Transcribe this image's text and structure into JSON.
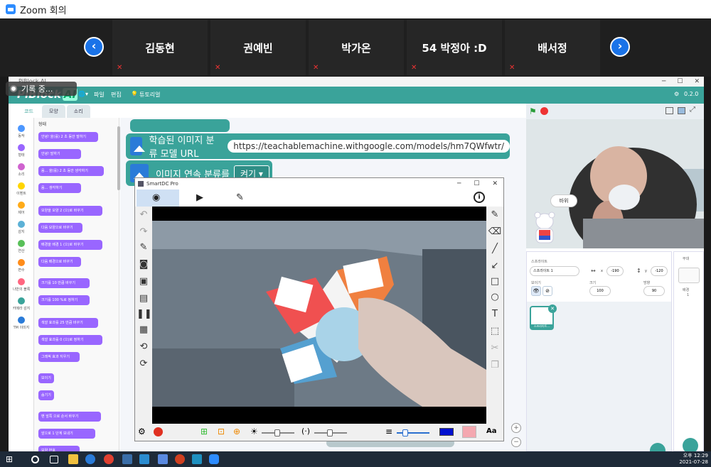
{
  "zoom": {
    "title": "Zoom 회의"
  },
  "participants": [
    "김동현",
    "권예빈",
    "박가온",
    "54 박정아 :D",
    "배서정"
  ],
  "piblock": {
    "window_title": "PiBlock AI",
    "logo": "PiBlock",
    "logo_ai": "AI",
    "recording": "기록 중...",
    "menus": [
      "파일",
      "편집",
      "튜토리얼"
    ],
    "version": "0.2.0",
    "tabs": [
      "코드",
      "모양",
      "소리"
    ],
    "categories": [
      {
        "label": "동작",
        "color": "#4c97ff"
      },
      {
        "label": "형태",
        "color": "#9966ff"
      },
      {
        "label": "소리",
        "color": "#cf63cf"
      },
      {
        "label": "이벤트",
        "color": "#ffd500"
      },
      {
        "label": "제어",
        "color": "#ffab19"
      },
      {
        "label": "감지",
        "color": "#5cb1d6"
      },
      {
        "label": "연산",
        "color": "#59c059"
      },
      {
        "label": "변수",
        "color": "#ff8c1a"
      },
      {
        "label": "나만의 블록",
        "color": "#ff6680"
      },
      {
        "label": "카메라 감지",
        "color": "#3aa39a"
      },
      {
        "label": "TM 이미지",
        "color": "#2a7bd8"
      }
    ],
    "palette_heading": "형태",
    "palette_blocks": [
      "안녕! 을(를) 2 초 동안 말하기",
      "안녕! 말하기",
      "음... 을(를) 2 초 동안 생각하기",
      "음... 생각하기",
      "모양을 모양 2 (으)로 바꾸기",
      "다음 모양으로 바꾸기",
      "배경을 배경 1 (으)로 바꾸기",
      "다음 배경으로 바꾸기",
      "크기를 10 만큼 바꾸기",
      "크기를 100 %로 정하기",
      "색깔 효과를 25 만큼 바꾸기",
      "색깔 효과를 0 (으)로 정하기",
      "그래픽 효과 지우기",
      "보이기",
      "숨기기",
      "맨 앞쪽 으로 순서 바꾸기",
      "앞으로 1 단계 보내기",
      "모양 번호"
    ],
    "code_blocks": {
      "model_label": "학습된 이미지 분류 모델 URL",
      "model_url": "https://teachablemachine.withgoogle.com/models/hm7QWfwtr/",
      "continuous_label": "이미지 연속 분류를",
      "continuous_value": "켜기"
    },
    "stage": {
      "speech": "바위"
    },
    "sprite_panel": {
      "sprite_label": "스프라이트",
      "sprite_name": "스프라이트 1",
      "x_label": "x",
      "x_value": "-190",
      "y_label": "y",
      "y_value": "-120",
      "show_label": "보이기",
      "size_label": "크기",
      "size_value": "100",
      "direction_label": "방향",
      "direction_value": "90",
      "thumb_label": "스프라이트..."
    },
    "backdrop_panel": {
      "title": "무대",
      "label": "배경",
      "count": "1"
    }
  },
  "smartdc": {
    "title": "SmartDC Pro"
  },
  "taskbar": {
    "time": "오후 12:29",
    "date": "2021-07-28"
  }
}
